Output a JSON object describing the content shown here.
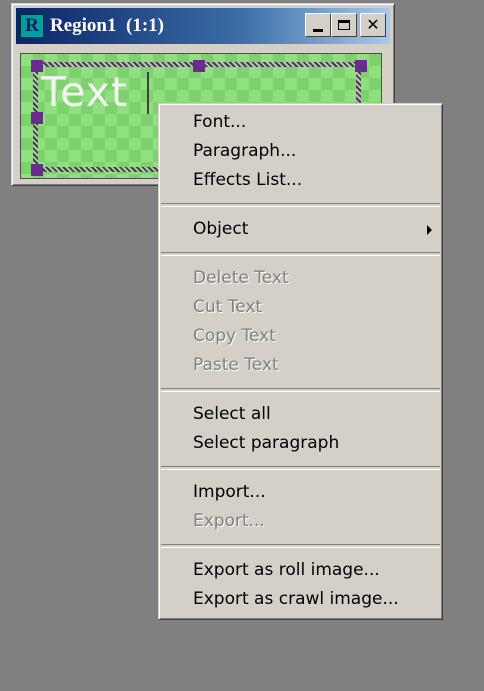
{
  "window": {
    "title": "Region1  (1:1)",
    "icon_letter": "R",
    "canvas_text": "Text"
  },
  "menu": {
    "font": "Font...",
    "paragraph": "Paragraph...",
    "effects_list": "Effects List...",
    "object": "Object",
    "delete_text": "Delete Text",
    "cut_text": "Cut Text",
    "copy_text": "Copy Text",
    "paste_text": "Paste Text",
    "select_all": "Select all",
    "select_paragraph": "Select paragraph",
    "import": "Import...",
    "export": "Export...",
    "export_roll": "Export as roll image...",
    "export_crawl": "Export as crawl image..."
  },
  "colors": {
    "desktop": "#808080",
    "titlebar": "#0a246a",
    "menu_bg": "#d4d0c8",
    "canvas_green": "#90e080",
    "handle_purple": "#6a2c8a"
  },
  "icons": {
    "app": "r-app-icon",
    "minimize": "minimize-icon",
    "maximize": "maximize-icon",
    "close": "close-icon",
    "submenu": "submenu-arrow-icon"
  }
}
